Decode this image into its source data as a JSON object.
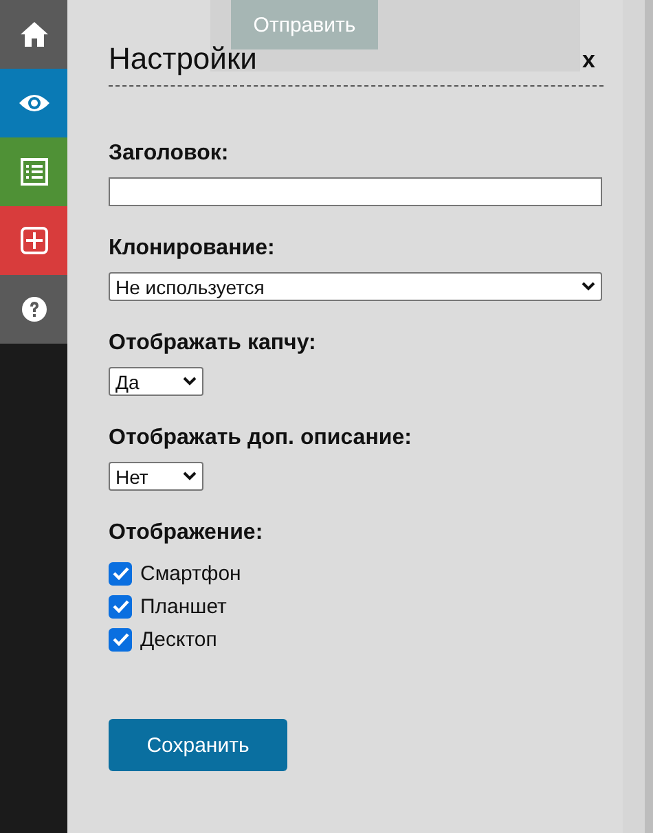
{
  "sidebar": {
    "items": [
      {
        "color": "#5a5a5a"
      },
      {
        "color": "#0a7ab5"
      },
      {
        "color": "#4f9136"
      },
      {
        "color": "#d83c3c"
      },
      {
        "color": "#5a5a5a"
      }
    ]
  },
  "background": {
    "button": "Отправить"
  },
  "panel": {
    "title": "Настройки",
    "close": "x",
    "fields": [
      {
        "kind": "text",
        "label": "Заголовок:"
      },
      {
        "kind": "select",
        "label": "Клонирование:",
        "value": "Не используется"
      },
      {
        "kind": "short_select",
        "label": "Отображать капчу:",
        "value": "Да"
      },
      {
        "kind": "short_select",
        "label": "Отображать доп. описание:",
        "value": "Нет"
      },
      {
        "kind": "checks",
        "label": "Отображение:",
        "options": [
          {
            "label": "Смартфон",
            "checked": true
          },
          {
            "label": "Планшет",
            "checked": true
          },
          {
            "label": "Десктоп",
            "checked": true
          }
        ]
      }
    ],
    "save": "Сохранить"
  }
}
